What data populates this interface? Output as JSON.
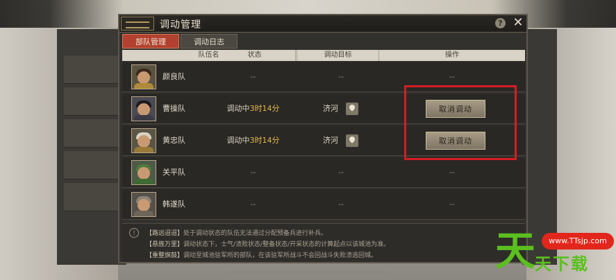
{
  "dialog": {
    "title": "调动管理",
    "help": "?",
    "close": "✕"
  },
  "tabs": [
    {
      "label": "部队管理",
      "active": true
    },
    {
      "label": "调动日志",
      "active": false
    }
  ],
  "table": {
    "headers": [
      "队伍名",
      "状态",
      "调动目标",
      "操作"
    ],
    "rows": [
      {
        "name": "颜良队",
        "status_prefix": "",
        "status_time": "",
        "status_dash": "--",
        "target": "",
        "target_dash": "--",
        "action": "",
        "action_dash": "--"
      },
      {
        "name": "曹操队",
        "status_prefix": "调动中",
        "status_time": "3时14分",
        "status_dash": "",
        "target": "济河",
        "target_dash": "",
        "action": "取消调动",
        "action_dash": ""
      },
      {
        "name": "黄忠队",
        "status_prefix": "调动中",
        "status_time": "3时14分",
        "status_dash": "",
        "target": "济河",
        "target_dash": "",
        "action": "取消调动",
        "action_dash": ""
      },
      {
        "name": "关平队",
        "status_prefix": "",
        "status_time": "",
        "status_dash": "--",
        "target": "",
        "target_dash": "--",
        "action": "",
        "action_dash": "--"
      },
      {
        "name": "韩遂队",
        "status_prefix": "",
        "status_time": "",
        "status_dash": "--",
        "target": "",
        "target_dash": "--",
        "action": "",
        "action_dash": "--"
      }
    ]
  },
  "notes": {
    "icon": "!",
    "items": [
      {
        "key": "【路远迢迢】",
        "text": "处于调动状态的队伍无法通过分配预备兵进行补兵。"
      },
      {
        "key": "【悬旌万里】",
        "text": "调动状态下，士气/溃败状态/整备状态/开采状态的计算起点以该城池为准。"
      },
      {
        "key": "【重整旗鼓】",
        "text": "调动至城池驻军所的部队，在该驻军所战斗不会回战斗失败溃逃回城。"
      }
    ]
  },
  "watermark": {
    "big": "天",
    "url": "www.TTsjp.com",
    "text": "天下载"
  },
  "colors": {
    "accent_tab": "#b2412f",
    "time_text": "#e2b84f",
    "highlight_box": "#d41e24",
    "watermark_green": "#5bbf1e"
  }
}
